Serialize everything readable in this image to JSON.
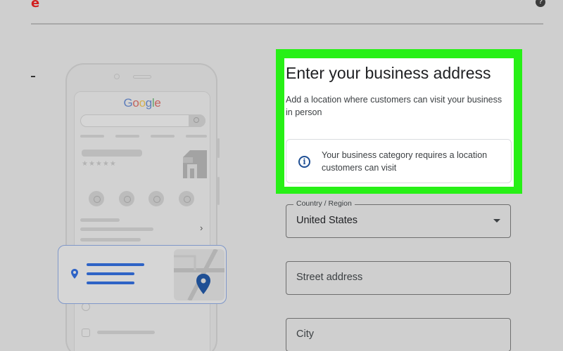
{
  "topbar": {
    "brand_mark": "e",
    "help_icon": "?"
  },
  "illustration": {
    "logo_text": "Google",
    "stars": "★★★★★",
    "chevron": "›"
  },
  "panel": {
    "title": "Enter your business address",
    "subtitle": "Add a location where customers can visit your business in person",
    "notice": "Your business category requires a location customers can visit",
    "highlight_color": "#27f016"
  },
  "form": {
    "country": {
      "label": "Country / Region",
      "value": "United States"
    },
    "street": {
      "placeholder": "Street address"
    },
    "city": {
      "placeholder": "City"
    }
  },
  "colors": {
    "accent_blue": "#2e63c6",
    "brand_red": "#d21f1f"
  }
}
